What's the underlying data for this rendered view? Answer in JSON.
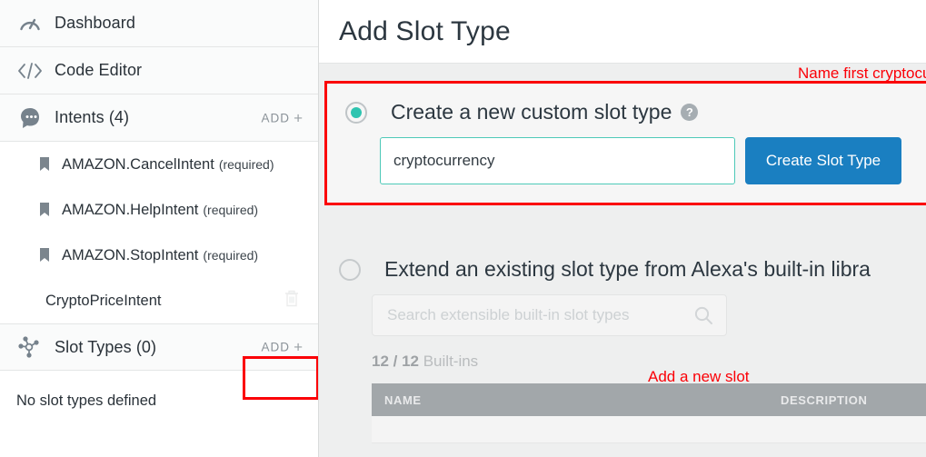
{
  "sidebar": {
    "nav": [
      {
        "label": "Dashboard",
        "icon": "gauge-icon",
        "add": null
      },
      {
        "label": "Code Editor",
        "icon": "code-icon",
        "add": null
      },
      {
        "label": "Intents (4)",
        "icon": "intents-icon",
        "add": "ADD"
      }
    ],
    "intents": [
      {
        "name": "AMAZON.CancelIntent",
        "suffix": "(required)",
        "icon": "bookmark-icon",
        "deletable": false
      },
      {
        "name": "AMAZON.HelpIntent",
        "suffix": "(required)",
        "icon": "bookmark-icon",
        "deletable": false
      },
      {
        "name": "AMAZON.StopIntent",
        "suffix": "(required)",
        "icon": "bookmark-icon",
        "deletable": false
      },
      {
        "name": "CryptoPriceIntent",
        "suffix": "",
        "icon": "",
        "deletable": true
      }
    ],
    "slot_types": {
      "label": "Slot Types (0)",
      "icon": "nodes-icon",
      "add": "ADD",
      "empty_text": "No slot types defined"
    },
    "add_plus_glyph": "+"
  },
  "main": {
    "title": "Add Slot Type",
    "custom": {
      "radio_label": "Create a new custom slot type",
      "selected": true,
      "help_icon": "help-icon",
      "input_value": "cryptocurrency",
      "input_placeholder": "",
      "button_label": "Create Slot Type"
    },
    "extend": {
      "radio_label": "Extend an existing slot type from Alexa's built-in libra",
      "selected": false,
      "search_placeholder": "Search extensible built-in slot types",
      "search_value": "",
      "search_icon": "search-icon",
      "count_bold": "12 / 12",
      "count_rest": " Built-ins",
      "table": {
        "columns": [
          "NAME",
          "DESCRIPTION"
        ],
        "rows": []
      }
    }
  },
  "annotations": [
    {
      "text": "Name first cryptocurrency and second currency",
      "color": "#fb0007"
    },
    {
      "text": "Add a new slot",
      "color": "#fb0007"
    }
  ],
  "colors": {
    "accent_teal": "#2ec4b0",
    "primary_blue": "#1a7fc1",
    "annotation_red": "#fb0007",
    "panel_bg": "#eeefef",
    "table_header": "#a2a7aa"
  }
}
